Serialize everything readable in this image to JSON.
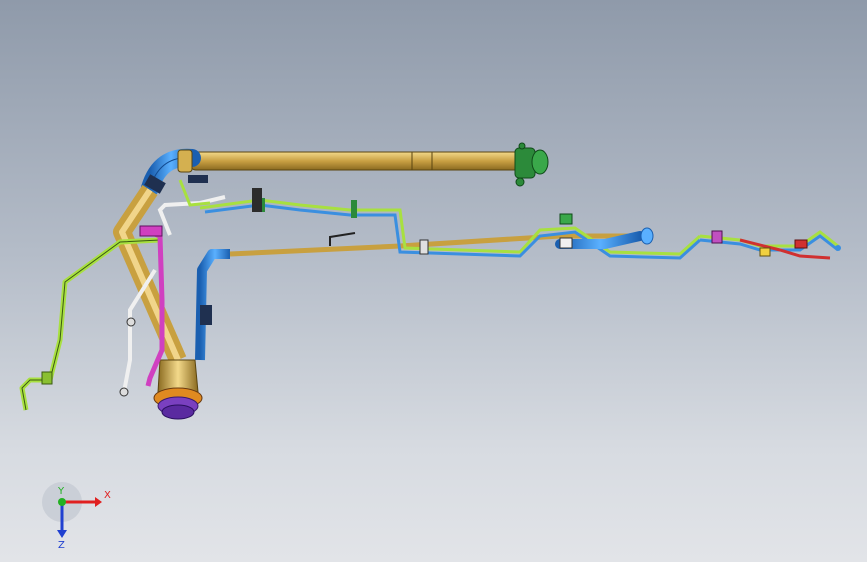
{
  "viewport": {
    "background_top": "#8f9aaa",
    "background_bottom": "#e2e4e8"
  },
  "triad": {
    "x_label": "X",
    "y_label": "Y",
    "z_label": "Z",
    "x_color": "#e02020",
    "y_color": "#22b022",
    "z_color": "#2040d0"
  },
  "model": {
    "colors": {
      "main_tube": "#c8a040",
      "blue_hose": "#3a8fe0",
      "green_hose": "#a8e040",
      "magenta_hose": "#d040c0",
      "white_hose": "#f0f0f0",
      "green_fitting": "#2c8a3a",
      "purple_base": "#7a40c0",
      "orange_ring": "#e08a20",
      "red_part": "#d03030"
    }
  }
}
